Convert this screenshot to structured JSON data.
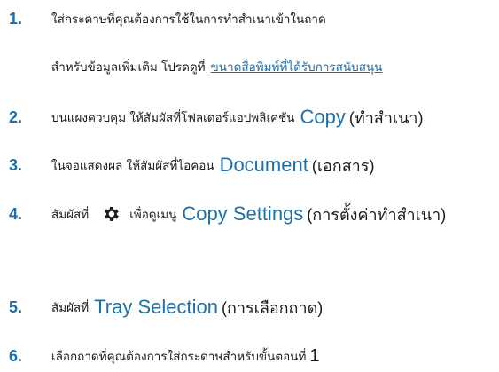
{
  "colors": {
    "accent": "#1f6fa8",
    "text": "#1a1a1a",
    "gear_icon": "#1f1f1f"
  },
  "steps": [
    {
      "number": "1.",
      "text": "ใส่กระดาษที่คุณต้องการใช้ในการทำสำเนาเข้าในถาด"
    },
    {
      "note": "สำหรับข้อมูลเพิ่มเติม โปรดดูที่",
      "link": "ขนาดสื่อพิมพ์ที่ได้รับการสนับสนุน"
    },
    {
      "number": "2.",
      "text": "บนแผงควบคุม ให้สัมผัสที่โฟลเดอร์แอปพลิเคชัน",
      "accent": "Copy",
      "paren": "(ทำสำเนา)"
    },
    {
      "number": "3.",
      "text": "ในจอแสดงผล ให้สัมผัสที่ไอคอน",
      "accent": "Document",
      "paren": "(เอกสาร)"
    },
    {
      "number": "4.",
      "text_before": "สัมผัสที่",
      "icon": "gear-icon",
      "text_after": "เพื่อดูเมนู",
      "accent": "Copy Settings",
      "paren": "(การตั้งค่าทำสำเนา)"
    },
    {
      "number": "5.",
      "text": "สัมผัสที่",
      "accent": "Tray Selection",
      "paren": "(การเลือกถาด)"
    },
    {
      "number": "6.",
      "text": "เลือกถาดที่คุณต้องการใส่กระดาษสำหรับขั้นตอนที่",
      "step_ref": "1"
    }
  ]
}
